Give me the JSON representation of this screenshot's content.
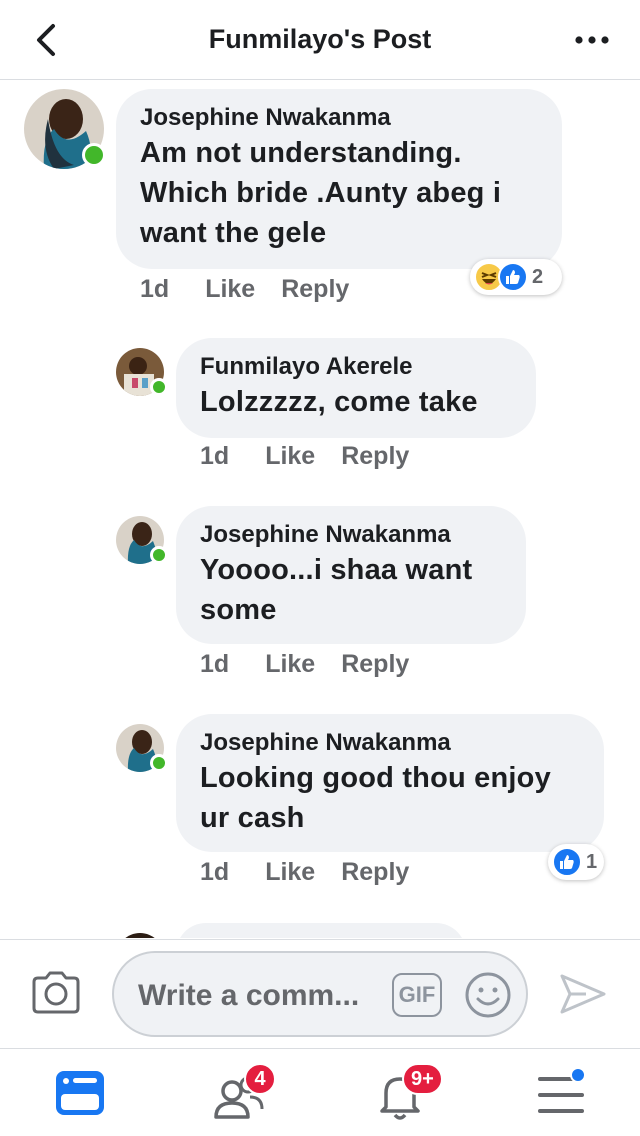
{
  "header": {
    "title": "Funmilayo's Post"
  },
  "comments": [
    {
      "author": "Josephine Nwakanma",
      "text_lines": [
        "Am not understanding.",
        "Which bride .Aunty abeg i",
        "want the gele"
      ],
      "time": "1d",
      "like": "Like",
      "reply": "Reply",
      "reaction_icons": [
        "laughing-icon",
        "like-icon"
      ],
      "reaction_count": "2"
    },
    {
      "author": "Funmilayo Akerele",
      "text_lines": [
        "Lolzzzzz, come take"
      ],
      "time": "1d",
      "like": "Like",
      "reply": "Reply"
    },
    {
      "author": "Josephine Nwakanma",
      "text_lines": [
        "Yoooo...i shaa want",
        "some"
      ],
      "time": "1d",
      "like": "Like",
      "reply": "Reply"
    },
    {
      "author": "Josephine Nwakanma",
      "text_lines": [
        "Looking good thou enjoy",
        "ur cash"
      ],
      "time": "1d",
      "like": "Like",
      "reply": "Reply",
      "reaction_icons": [
        "like-icon"
      ],
      "reaction_count": "1"
    }
  ],
  "composer": {
    "placeholder": "Write a comm...",
    "gif_label": "GIF"
  },
  "bottom_nav": {
    "friends_badge": "4",
    "notifications_badge": "9+"
  },
  "colors": {
    "accent": "#1877f2",
    "online": "#42b72a",
    "badge": "#e41e3f",
    "bubble": "#f0f2f5"
  }
}
